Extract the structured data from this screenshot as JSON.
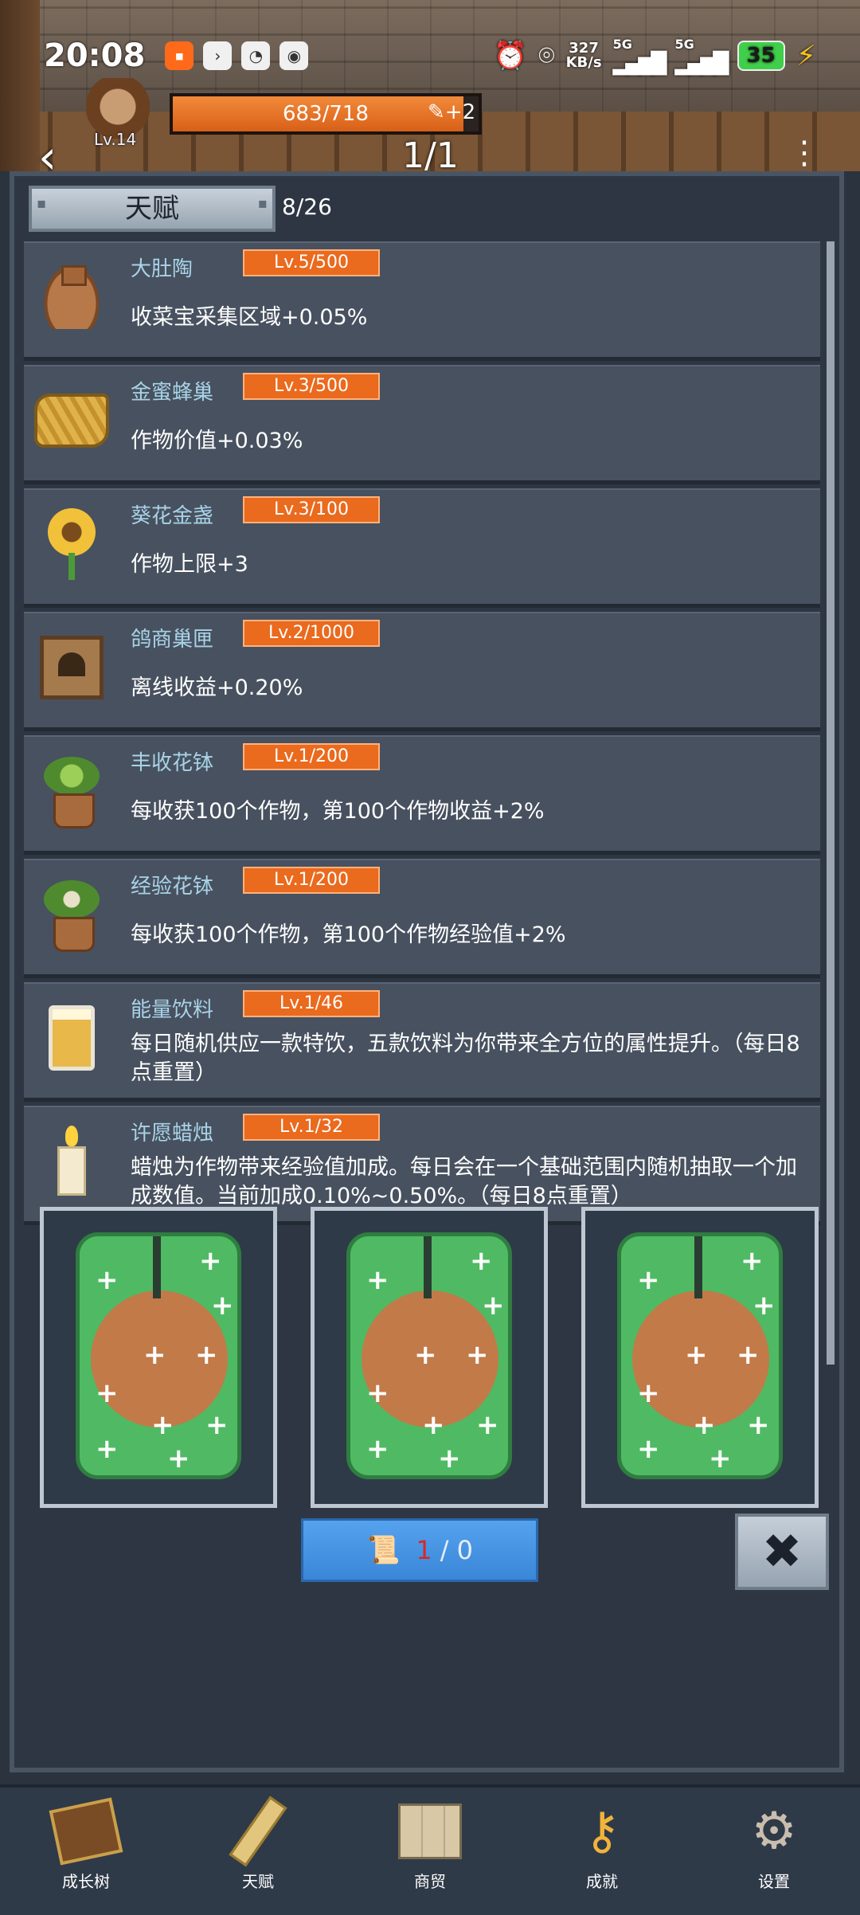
{
  "status_bar": {
    "time": "20:08",
    "net_speed_value": "327",
    "net_speed_unit": "KB/s",
    "sim1": "5G",
    "sim2": "5G",
    "battery": "35"
  },
  "player": {
    "level": "Lv.14",
    "hp_text": "683/718",
    "hp_fraction": 0.951,
    "scroll_bonus": "+2",
    "page_indicator": "1/1"
  },
  "talent_panel": {
    "title": "天赋",
    "count": "8/26",
    "items": [
      {
        "name": "大肚陶",
        "level": "Lv.5/500",
        "desc": "收菜宝采集区域+0.05%",
        "icon": "clay-jar-icon"
      },
      {
        "name": "金蜜蜂巢",
        "level": "Lv.3/500",
        "desc": "作物价值+0.03%",
        "icon": "honeycomb-icon"
      },
      {
        "name": "葵花金盏",
        "level": "Lv.3/100",
        "desc": "作物上限+3",
        "icon": "sunflower-icon"
      },
      {
        "name": "鸽商巢匣",
        "level": "Lv.2/1000",
        "desc": "离线收益+0.20%",
        "icon": "pigeon-box-icon"
      },
      {
        "name": "丰收花钵",
        "level": "Lv.1/200",
        "desc": "每收获100个作物，第100个作物收益+2%",
        "icon": "flower-pot-icon"
      },
      {
        "name": "经验花钵",
        "level": "Lv.1/200",
        "desc": "每收获100个作物，第100个作物经验值+2%",
        "icon": "exp-flower-pot-icon"
      },
      {
        "name": "能量饮料",
        "level": "Lv.1/46",
        "desc": "每日随机供应一款特饮，五款饮料为你带来全方位的属性提升。（每日8点重置）",
        "icon": "energy-drink-icon"
      },
      {
        "name": "许愿蜡烛",
        "level": "Lv.1/32",
        "desc": "蜡烛为作物带来经验值加成。每日会在一个基础范围内随机抽取一个加成数值。当前加成0.10%~0.50%。（每日8点重置）",
        "icon": "candle-icon"
      }
    ]
  },
  "draw": {
    "scroll_current": "1",
    "separator": "/",
    "scroll_max": "0",
    "close_label": "✖"
  },
  "bottom_nav": [
    {
      "label": "成长树",
      "icon": "book-icon"
    },
    {
      "label": "天赋",
      "icon": "scroll-icon"
    },
    {
      "label": "商贸",
      "icon": "map-icon"
    },
    {
      "label": "成就",
      "icon": "key-icon"
    },
    {
      "label": "设置",
      "icon": "gear-icon"
    }
  ],
  "colors": {
    "accent_orange": "#ea6a1e",
    "name_blue": "#a8d3e8",
    "button_blue": "#3a86d8",
    "panel_bg": "#2d3642",
    "row_bg": "#48515f"
  }
}
